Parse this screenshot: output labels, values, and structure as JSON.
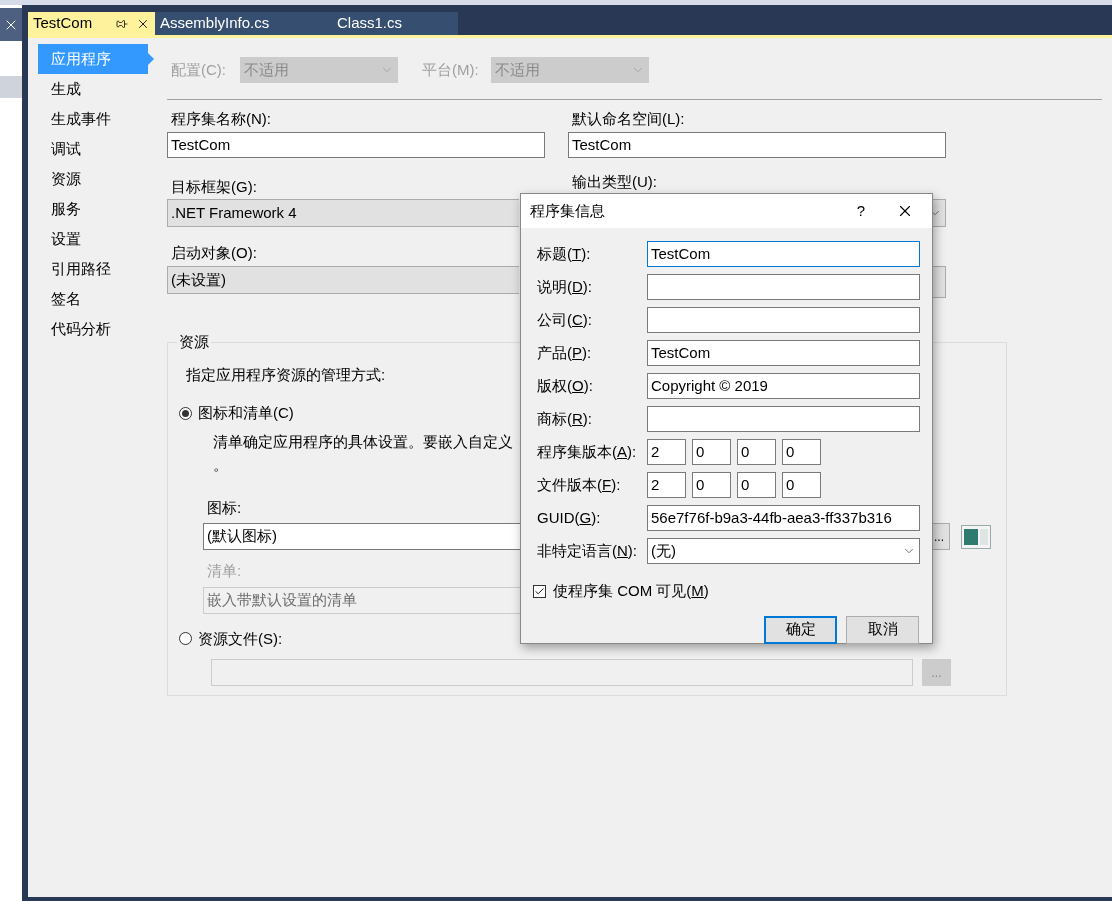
{
  "tabs": [
    {
      "label": "TestCom",
      "selected": true
    },
    {
      "label": "AssemblyInfo.cs",
      "selected": false
    },
    {
      "label": "Class1.cs",
      "selected": false
    }
  ],
  "sidebar": {
    "items": [
      {
        "label": "应用程序",
        "selected": true
      },
      {
        "label": "生成",
        "selected": false
      },
      {
        "label": "生成事件",
        "selected": false
      },
      {
        "label": "调试",
        "selected": false
      },
      {
        "label": "资源",
        "selected": false
      },
      {
        "label": "服务",
        "selected": false
      },
      {
        "label": "设置",
        "selected": false
      },
      {
        "label": "引用路径",
        "selected": false
      },
      {
        "label": "签名",
        "selected": false
      },
      {
        "label": "代码分析",
        "selected": false
      }
    ]
  },
  "configuration": {
    "label": "配置(C):",
    "value": "不适用",
    "disabled": true
  },
  "platform": {
    "label": "平台(M):",
    "value": "不适用",
    "disabled": true
  },
  "assembly_name": {
    "label": "程序集名称(N):",
    "value": "TestCom"
  },
  "default_namespace": {
    "label": "默认命名空间(L):",
    "value": "TestCom"
  },
  "target_framework": {
    "label": "目标框架(G):",
    "value": ".NET Framework 4"
  },
  "output_type": {
    "label": "输出类型(U):"
  },
  "startup_object": {
    "label": "启动对象(O):",
    "value": "(未设置)"
  },
  "resources": {
    "title": "资源",
    "instruction": "指定应用程序资源的管理方式:",
    "icon_manifest_option": {
      "label": "图标和清单(C)",
      "selected": true
    },
    "description": [
      "清单确定应用程序的具体设置。要嵌入自定义",
      "。"
    ],
    "icon": {
      "label": "图标:",
      "value": "(默认图标)",
      "browse": "..."
    },
    "manifest": {
      "label": "清单:",
      "value": "嵌入带默认设置的清单",
      "disabled": true
    },
    "resource_file_option": {
      "label": "资源文件(S):",
      "selected": false
    },
    "resource_file": {
      "browse": "...",
      "disabled": true
    }
  },
  "dialog": {
    "title": "程序集信息",
    "help": "?",
    "fields": [
      {
        "kind": "text",
        "label": "标题(",
        "key": "T",
        "suffix": "):",
        "value": "TestCom",
        "focused": true
      },
      {
        "kind": "text",
        "label": "说明(",
        "key": "D",
        "suffix": "):",
        "focused": false
      },
      {
        "kind": "text",
        "label": "公司(",
        "key": "C",
        "suffix": "):",
        "focused": false
      },
      {
        "kind": "text",
        "label": "产品(",
        "key": "P",
        "suffix": "):",
        "value": "TestCom",
        "focused": false
      },
      {
        "kind": "text",
        "label": "版权(",
        "key": "O",
        "suffix": "):",
        "value": "Copyright ©  2019",
        "focused": false
      },
      {
        "kind": "text",
        "label": "商标(",
        "key": "R",
        "suffix": "):",
        "focused": false
      },
      {
        "kind": "version",
        "label": "程序集版本(",
        "key": "A",
        "suffix": "):",
        "parts": [
          "2",
          "0",
          "0",
          "0"
        ]
      },
      {
        "kind": "version",
        "label": "文件版本(",
        "key": "F",
        "suffix": "):",
        "parts": [
          "2",
          "0",
          "0",
          "0"
        ]
      },
      {
        "kind": "text",
        "label": "GUID(",
        "key": "G",
        "suffix": "):",
        "value": "56e7f76f-b9a3-44fb-aea3-ff337b316",
        "focused": false
      },
      {
        "kind": "dropdown",
        "label": "非特定语言(",
        "key": "N",
        "suffix": "):",
        "value": "(无)"
      }
    ],
    "com_visible": {
      "label": "使程序集 COM 可见(",
      "key": "M",
      "suffix": ")",
      "checked": true
    },
    "buttons": [
      {
        "label": "确定",
        "default": true
      },
      {
        "label": "取消",
        "default": false
      }
    ]
  }
}
